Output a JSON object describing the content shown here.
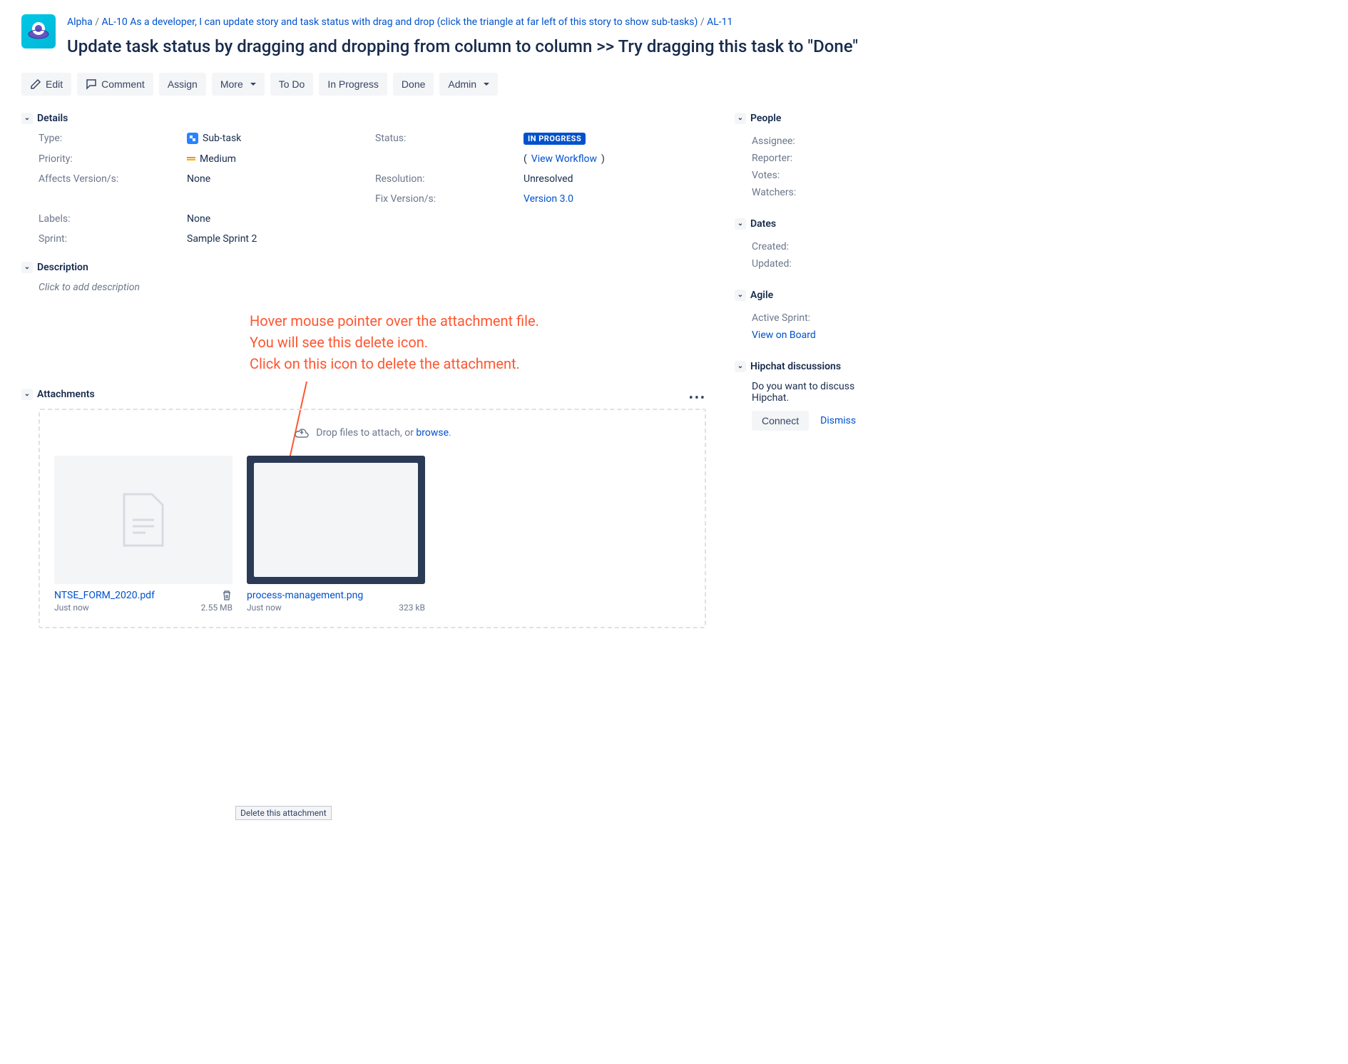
{
  "breadcrumb": {
    "project": "Alpha",
    "parent": "AL-10 As a developer, I can update story and task status with drag and drop (click the triangle at far left of this story to show sub-tasks)",
    "key": "AL-11"
  },
  "title": "Update task status by dragging and dropping from column to column >> Try dragging this task to \"Done\"",
  "toolbar": {
    "edit": "Edit",
    "comment": "Comment",
    "assign": "Assign",
    "more": "More",
    "todo": "To Do",
    "inprogress": "In Progress",
    "done": "Done",
    "admin": "Admin"
  },
  "sections": {
    "details": "Details",
    "description": "Description",
    "attachments": "Attachments",
    "people": "People",
    "dates": "Dates",
    "agile": "Agile",
    "hipchat": "Hipchat discussions"
  },
  "details": {
    "type_label": "Type:",
    "type_value": "Sub-task",
    "priority_label": "Priority:",
    "priority_value": "Medium",
    "affects_label": "Affects Version/s:",
    "affects_value": "None",
    "labels_label": "Labels:",
    "labels_value": "None",
    "sprint_label": "Sprint:",
    "sprint_value": "Sample Sprint 2",
    "status_label": "Status:",
    "status_value": "IN PROGRESS",
    "view_workflow": "View Workflow",
    "resolution_label": "Resolution:",
    "resolution_value": "Unresolved",
    "fixversion_label": "Fix Version/s:",
    "fixversion_value": "Version 3.0"
  },
  "description": {
    "placeholder": "Click to add description"
  },
  "annotation": {
    "line1": "Hover mouse pointer over the attachment file.",
    "line2": "You will see this delete icon.",
    "line3": "Click on this icon to delete the attachment."
  },
  "attachments": {
    "drop_text": "Drop files to attach, or ",
    "browse": "browse",
    "tooltip": "Delete this attachment",
    "items": [
      {
        "name": "NTSE_FORM_2020.pdf",
        "time": "Just now",
        "size": "2.55 MB"
      },
      {
        "name": "process-management.png",
        "time": "Just now",
        "size": "323 kB"
      }
    ]
  },
  "people": {
    "assignee": "Assignee:",
    "reporter": "Reporter:",
    "votes": "Votes:",
    "watchers": "Watchers:"
  },
  "dates": {
    "created": "Created:",
    "updated": "Updated:"
  },
  "agile": {
    "active_sprint": "Active Sprint:",
    "view_board": "View on Board"
  },
  "hipchat": {
    "text": "Do you want to discuss Hipchat.",
    "connect": "Connect",
    "dismiss": "Dismiss"
  }
}
